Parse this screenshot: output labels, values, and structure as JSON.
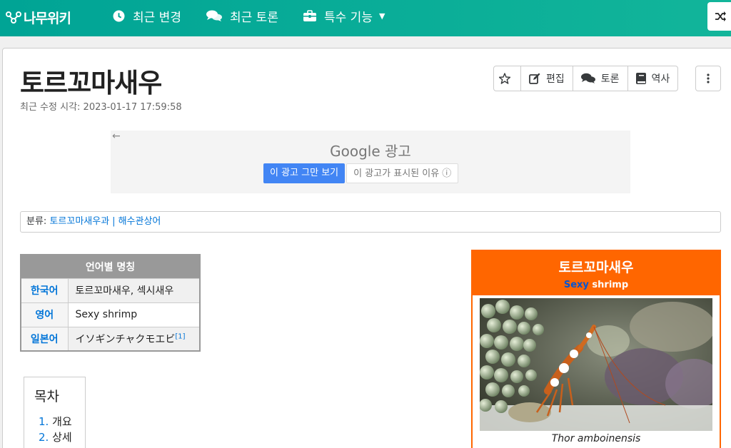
{
  "nav": {
    "logo": "나무위키",
    "recent_changes": "최근 변경",
    "recent_discuss": "최근 토론",
    "special": "특수 기능"
  },
  "page": {
    "title": "토르꼬마새우",
    "modified_label": "최근 수정 시각: ",
    "modified_time": "2023-01-17 17:59:58"
  },
  "toolbar": {
    "edit": "편집",
    "discuss": "토론",
    "history": "역사"
  },
  "ad": {
    "back": "←",
    "brand": "Google",
    "brand_suffix": " 광고",
    "stop": "이 광고 그만 보기",
    "why": "이 광고가 표시된 이유 ⓘ"
  },
  "category": {
    "label": "분류: ",
    "items": [
      "토르꼬마새우과",
      "해수관상어"
    ],
    "separator": "|"
  },
  "names_table": {
    "header": "언어별 명칭",
    "rows": [
      {
        "lang": "한국어",
        "value": "토르꼬마새우, 섹시새우",
        "note": ""
      },
      {
        "lang": "영어",
        "value": "Sexy shrimp",
        "note": ""
      },
      {
        "lang": "일본어",
        "value": "イソギンチャクモエビ",
        "note": "[1]"
      }
    ]
  },
  "toc": {
    "title": "목차",
    "items": [
      {
        "num": "1.",
        "label": "개요"
      },
      {
        "num": "2.",
        "label": "상세"
      }
    ]
  },
  "infobox": {
    "title": "토르꼬마새우",
    "sub_blue": "Sexy",
    "sub_rest": " shrimp",
    "caption": "Thor amboinensis"
  },
  "colors": {
    "nav": "#00a495",
    "infobox": "#ff6600",
    "link": "#0275d8"
  }
}
